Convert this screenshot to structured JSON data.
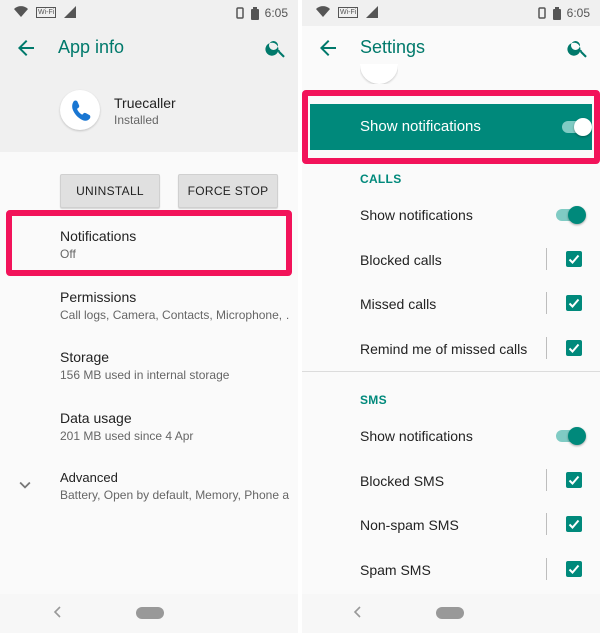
{
  "colors": {
    "accent": "#00897b",
    "highlight": "#f2135a",
    "header_bg": "#f0f0f0"
  },
  "status_bar": {
    "time": "6:05"
  },
  "left": {
    "title": "App info",
    "app": {
      "name": "Truecaller",
      "status": "Installed",
      "icon": "truecaller-phone-icon"
    },
    "buttons": {
      "uninstall": "UNINSTALL",
      "force_stop": "FORCE STOP"
    },
    "items": [
      {
        "title": "Notifications",
        "subtitle": "Off"
      },
      {
        "title": "Permissions",
        "subtitle": "Call logs, Camera, Contacts, Microphone, …"
      },
      {
        "title": "Storage",
        "subtitle": "156 MB used in internal storage"
      },
      {
        "title": "Data usage",
        "subtitle": "201 MB used since 4 Apr"
      },
      {
        "title": "Advanced",
        "subtitle": "Battery, Open by default, Memory, Phone a…"
      }
    ]
  },
  "right": {
    "title": "Settings",
    "master": {
      "label": "Show notifications",
      "enabled": true
    },
    "sections": [
      {
        "header": "CALLS",
        "rows": [
          {
            "label": "Show notifications",
            "control": "toggle",
            "on": true
          },
          {
            "label": "Blocked calls",
            "control": "checkbox",
            "checked": true
          },
          {
            "label": "Missed calls",
            "control": "checkbox",
            "checked": true
          },
          {
            "label": "Remind me of missed calls",
            "control": "checkbox",
            "checked": true
          }
        ]
      },
      {
        "header": "SMS",
        "rows": [
          {
            "label": "Show notifications",
            "control": "toggle",
            "on": true
          },
          {
            "label": "Blocked SMS",
            "control": "checkbox",
            "checked": true
          },
          {
            "label": "Non-spam SMS",
            "control": "checkbox",
            "checked": true
          },
          {
            "label": "Spam SMS",
            "control": "checkbox",
            "checked": true
          }
        ]
      }
    ]
  }
}
